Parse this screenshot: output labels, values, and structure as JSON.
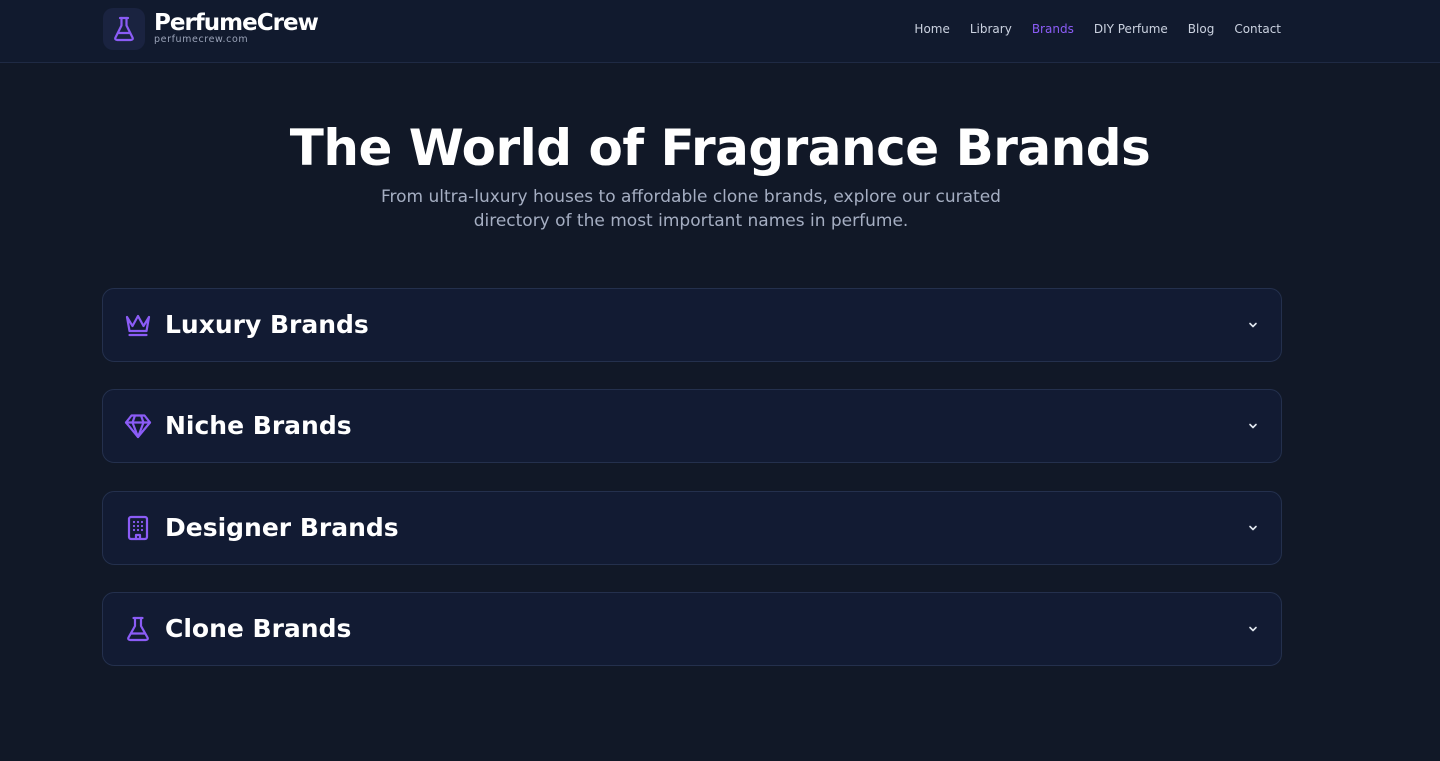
{
  "header": {
    "brand_name": "PerfumeCrew",
    "brand_domain": "perfumecrew.com",
    "logo_icon": "flask-icon",
    "nav": [
      {
        "label": "Home",
        "active": false
      },
      {
        "label": "Library",
        "active": false
      },
      {
        "label": "Brands",
        "active": true
      },
      {
        "label": "DIY Perfume",
        "active": false
      },
      {
        "label": "Blog",
        "active": false
      },
      {
        "label": "Contact",
        "active": false
      }
    ]
  },
  "hero": {
    "title": "The World of Fragrance Brands",
    "subtitle": "From ultra-luxury houses to affordable clone brands, explore our curated directory of the most important names in perfume."
  },
  "sections": [
    {
      "title": "Luxury Brands",
      "icon": "crown-icon",
      "expanded": false
    },
    {
      "title": "Niche Brands",
      "icon": "gem-icon",
      "expanded": false
    },
    {
      "title": "Designer Brands",
      "icon": "building-icon",
      "expanded": false
    },
    {
      "title": "Clone Brands",
      "icon": "flask-icon",
      "expanded": false
    }
  ],
  "colors": {
    "background": "#111827",
    "header_bg": "#111a2e",
    "card_bg": "#121b33",
    "card_border": "#24304d",
    "accent": "#8b5cf6",
    "text_primary": "#ffffff",
    "text_muted": "#a5aec2"
  }
}
